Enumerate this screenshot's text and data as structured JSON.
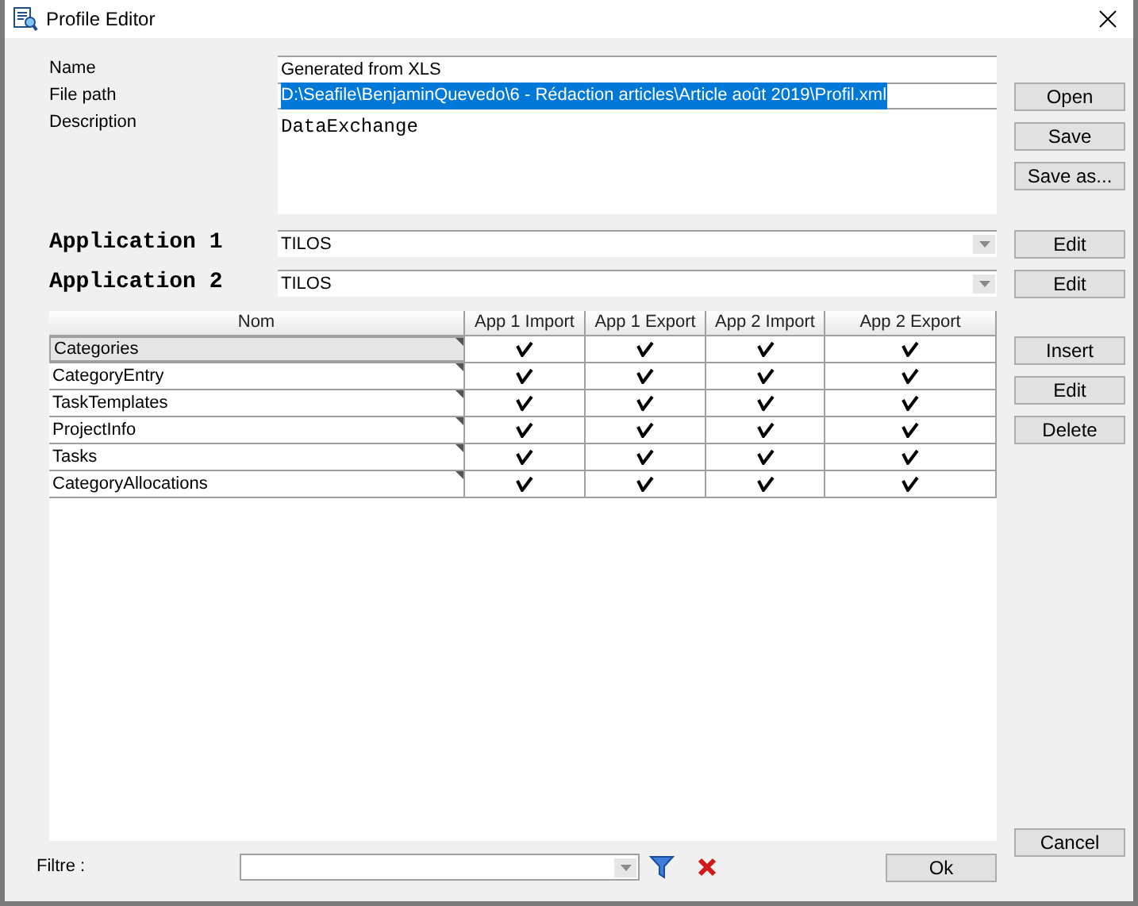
{
  "window": {
    "title": "Profile Editor"
  },
  "fields": {
    "name": {
      "label": "Name",
      "value": "Generated from XLS"
    },
    "file_path": {
      "label": "File path",
      "value": "D:\\Seafile\\BenjaminQuevedo\\6 - Rédaction articles\\Article août 2019\\Profil.xml",
      "selected": true
    },
    "description": {
      "label": "Description",
      "value": "DataExchange"
    }
  },
  "file_buttons": [
    "Open",
    "Save",
    "Save as..."
  ],
  "applications": [
    {
      "label": "Application 1",
      "value": "TILOS",
      "button": "Edit"
    },
    {
      "label": "Application 2",
      "value": "TILOS",
      "button": "Edit"
    }
  ],
  "table": {
    "columns": [
      "Nom",
      "App 1 Import",
      "App 1 Export",
      "App 2 Import",
      "App 2 Export"
    ],
    "rows": [
      {
        "name": "Categories",
        "selected": true,
        "checks": [
          true,
          true,
          true,
          true
        ]
      },
      {
        "name": "CategoryEntry",
        "selected": false,
        "checks": [
          true,
          true,
          true,
          true
        ]
      },
      {
        "name": "TaskTemplates",
        "selected": false,
        "checks": [
          true,
          true,
          true,
          true
        ]
      },
      {
        "name": "ProjectInfo",
        "selected": false,
        "checks": [
          true,
          true,
          true,
          true
        ]
      },
      {
        "name": "Tasks",
        "selected": false,
        "checks": [
          true,
          true,
          true,
          true
        ]
      },
      {
        "name": "CategoryAllocations",
        "selected": false,
        "checks": [
          true,
          true,
          true,
          true
        ]
      }
    ]
  },
  "table_buttons": [
    "Insert",
    "Edit",
    "Delete"
  ],
  "filter": {
    "label": "Filtre :"
  },
  "dialog_buttons": [
    "Ok",
    "Cancel"
  ]
}
